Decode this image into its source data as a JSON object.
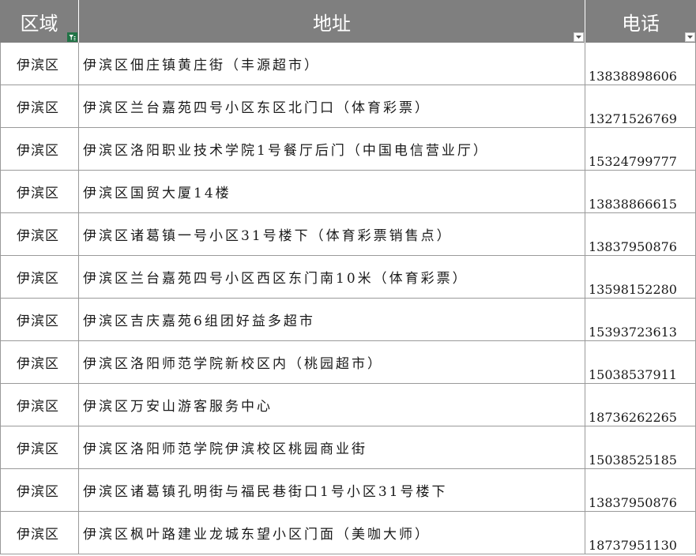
{
  "table": {
    "headers": [
      "区域",
      "地址",
      "电话"
    ],
    "rows": [
      {
        "region": "伊滨区",
        "address": "伊滨区佃庄镇黄庄街（丰源超市）",
        "phone": "13838898606"
      },
      {
        "region": "伊滨区",
        "address": "伊滨区兰台嘉苑四号小区东区北门口（体育彩票）",
        "phone": "13271526769"
      },
      {
        "region": "伊滨区",
        "address": "伊滨区洛阳职业技术学院1号餐厅后门（中国电信营业厅）",
        "phone": "15324799777"
      },
      {
        "region": "伊滨区",
        "address": "伊滨区国贸大厦14楼",
        "phone": "13838866615"
      },
      {
        "region": "伊滨区",
        "address": "伊滨区诸葛镇一号小区31号楼下（体育彩票销售点）",
        "phone": "13837950876"
      },
      {
        "region": "伊滨区",
        "address": "伊滨区兰台嘉苑四号小区西区东门南10米（体育彩票）",
        "phone": "13598152280"
      },
      {
        "region": "伊滨区",
        "address": "伊滨区吉庆嘉苑6组团好益多超市",
        "phone": "15393723613"
      },
      {
        "region": "伊滨区",
        "address": "伊滨区洛阳师范学院新校区内（桃园超市）",
        "phone": "15038537911"
      },
      {
        "region": "伊滨区",
        "address": "伊滨区万安山游客服务中心",
        "phone": "18736262265"
      },
      {
        "region": "伊滨区",
        "address": "伊滨区洛阳师范学院伊滨校区桃园商业街",
        "phone": "15038525185"
      },
      {
        "region": "伊滨区",
        "address": "伊滨区诸葛镇孔明街与福民巷街口1号小区31号楼下",
        "phone": "13837950876"
      },
      {
        "region": "伊滨区",
        "address": "伊滨区枫叶路建业龙城东望小区门面（美咖大师）",
        "phone": "18737951130"
      }
    ]
  },
  "icons": {
    "filter_active": "filter-funnel-icon",
    "dropdown": "dropdown-arrow-icon"
  },
  "colors": {
    "header_bg": "#7f7f7f",
    "filter_active_bg": "#217346"
  }
}
